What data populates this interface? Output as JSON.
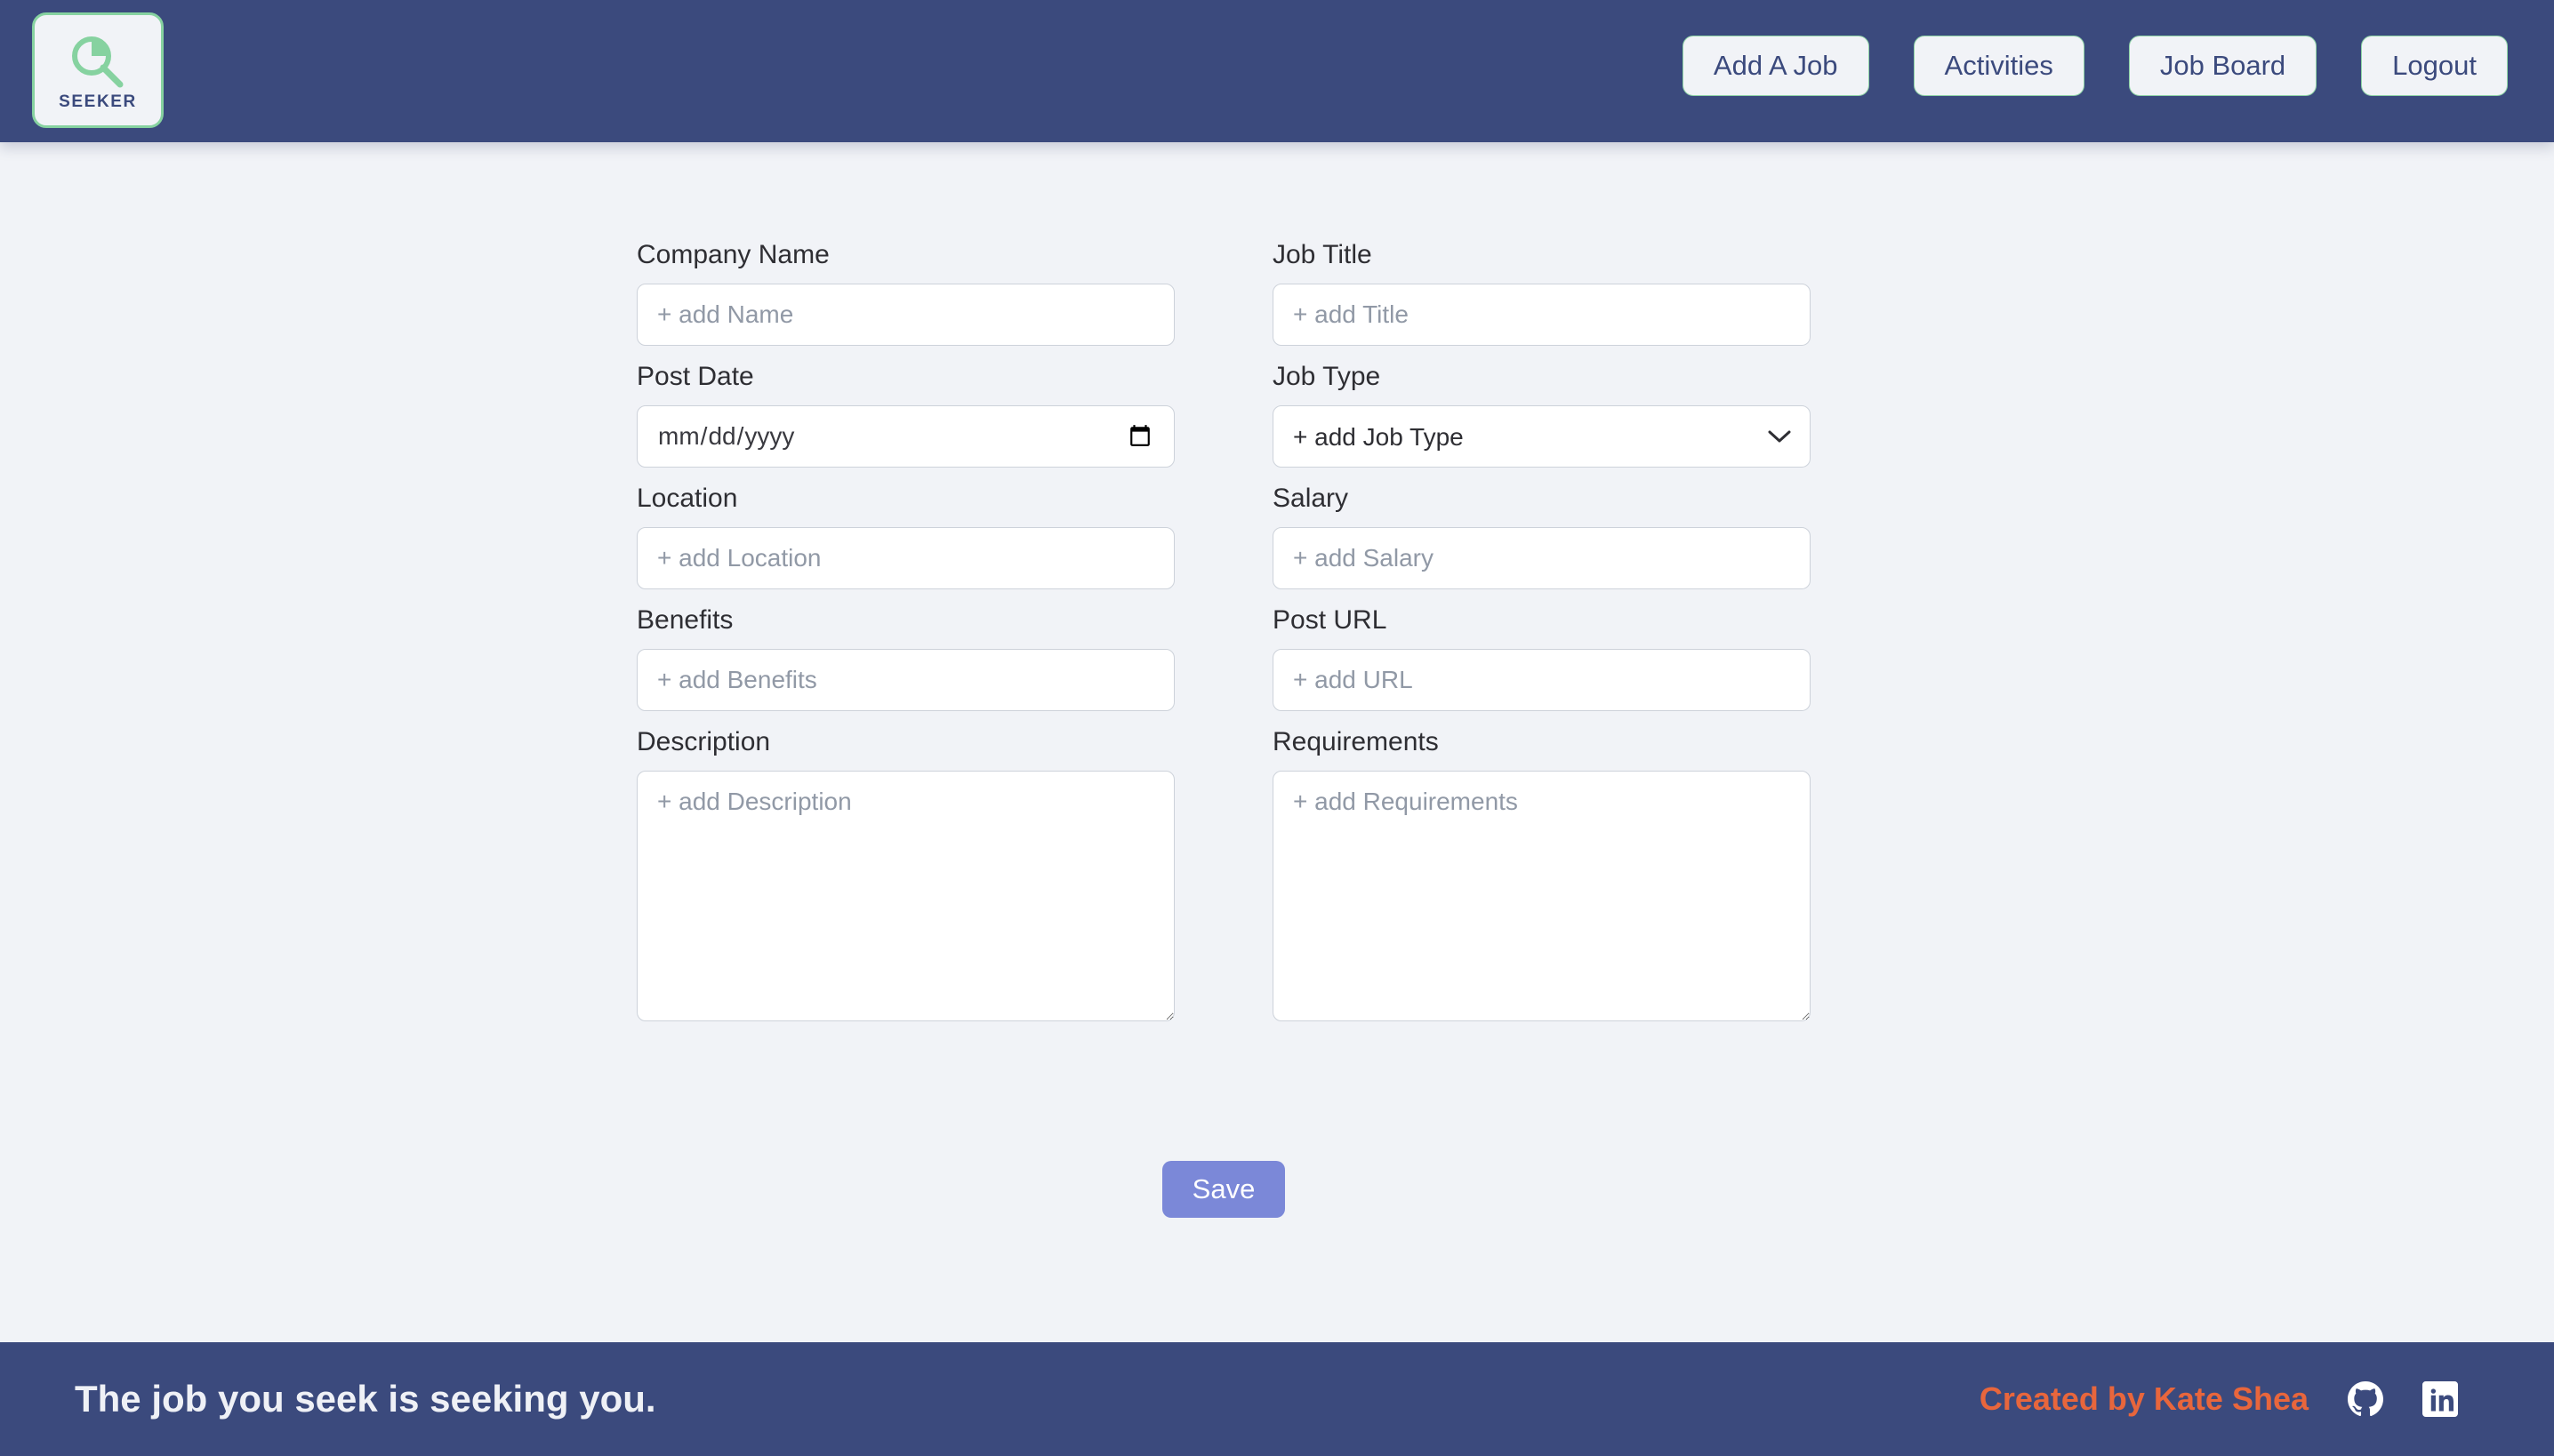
{
  "header": {
    "logo": {
      "word": "SEEKER",
      "icon": "magnifier-icon",
      "icon_color": "#86D2A0",
      "box_bg": "#F1F3F7"
    },
    "bar_color": "#3B4A7D",
    "nav": [
      {
        "label": "Add A Job",
        "name": "add-a-job"
      },
      {
        "label": "Activities",
        "name": "activities"
      },
      {
        "label": "Job Board",
        "name": "job-board"
      },
      {
        "label": "Logout",
        "name": "logout"
      }
    ]
  },
  "main": {
    "background": "#F1F3F7",
    "fields": {
      "company_name": {
        "label": "Company Name",
        "placeholder": "+ add Name",
        "value": ""
      },
      "job_title": {
        "label": "Job Title",
        "placeholder": "+ add Title",
        "value": ""
      },
      "post_date": {
        "label": "Post Date",
        "placeholder": "mm/dd/yyyy",
        "value": ""
      },
      "job_type": {
        "label": "Job Type",
        "selected": "+ add Job Type",
        "options": [
          "+ add Job Type"
        ]
      },
      "location": {
        "label": "Location",
        "placeholder": "+ add Location",
        "value": ""
      },
      "salary": {
        "label": "Salary",
        "placeholder": "+ add Salary",
        "value": ""
      },
      "benefits": {
        "label": "Benefits",
        "placeholder": "+ add Benefits",
        "value": ""
      },
      "post_url": {
        "label": "Post URL",
        "placeholder": "+ add URL",
        "value": ""
      },
      "description": {
        "label": "Description",
        "placeholder": "+ add Description",
        "value": ""
      },
      "requirements": {
        "label": "Requirements",
        "placeholder": "+ add Requirements",
        "value": ""
      }
    },
    "save_button": {
      "label": "Save",
      "color": "#7B88D8"
    }
  },
  "footer": {
    "tagline": "The job you seek is seeking you.",
    "credit": "Created by Kate Shea",
    "credit_color": "#E8663C",
    "bar_color": "#3B4A7D",
    "social": [
      {
        "name": "github-icon"
      },
      {
        "name": "linkedin-icon"
      }
    ]
  }
}
